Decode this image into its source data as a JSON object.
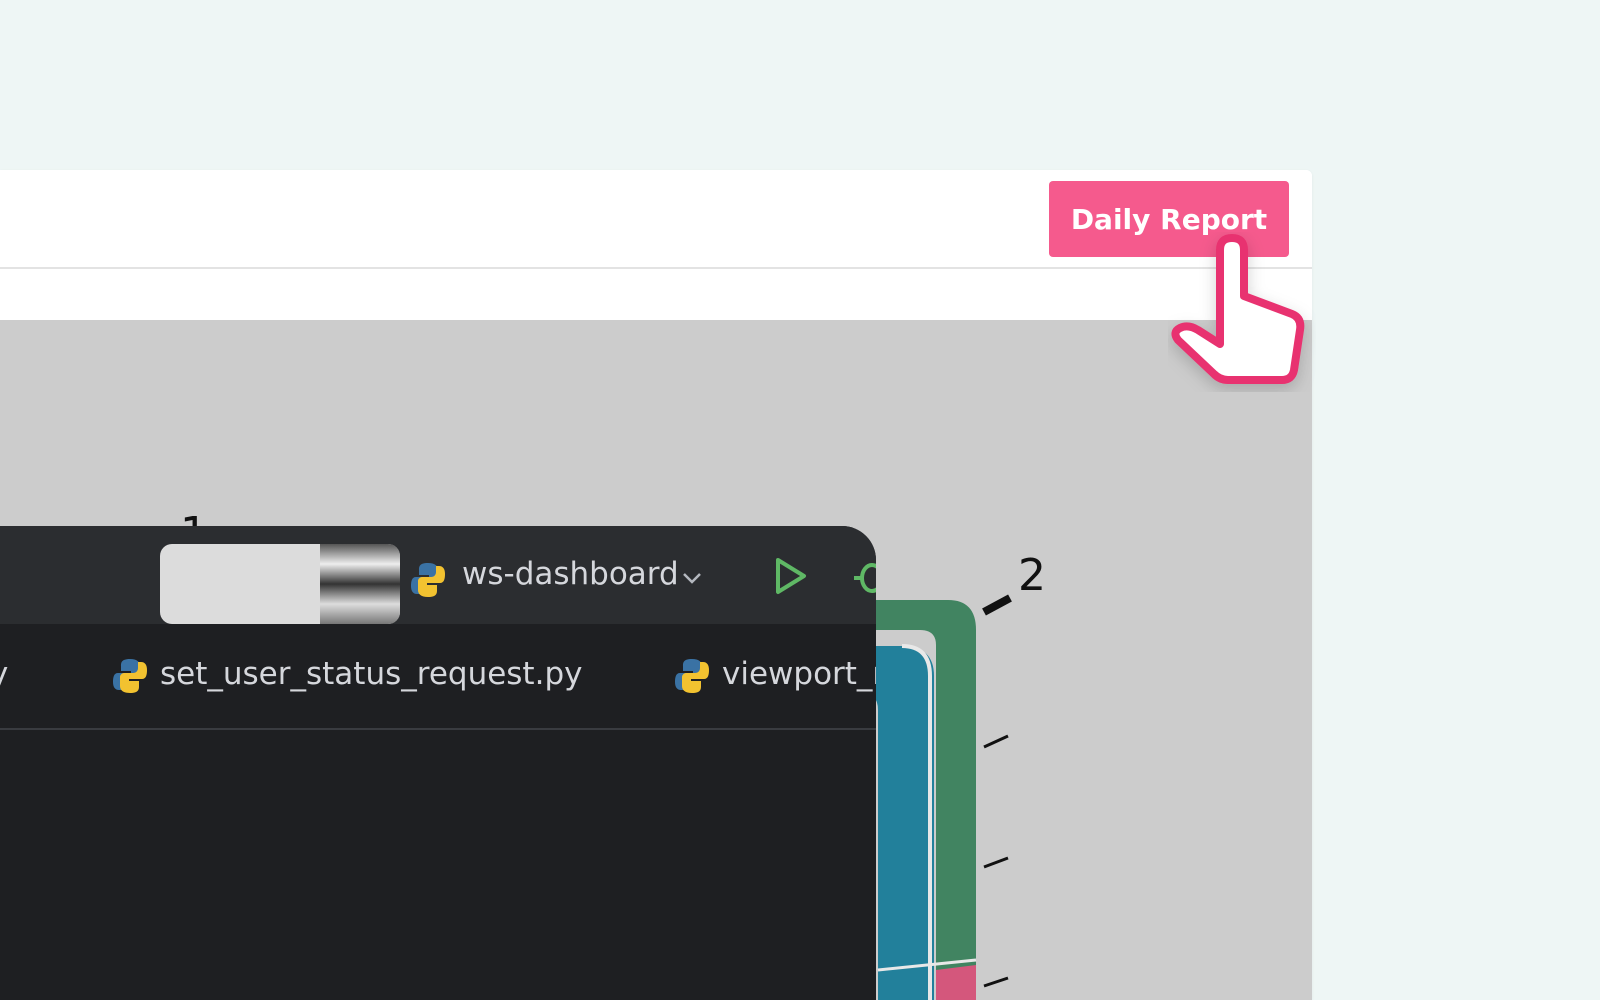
{
  "header": {
    "report_button_label": "Daily Report"
  },
  "ruler": {
    "labels": [
      "1",
      "2"
    ]
  },
  "ide": {
    "project_name": "ws-dashboard",
    "tabs": [
      {
        "label": "set_user_status_request.py"
      },
      {
        "label": "viewport_r"
      }
    ],
    "partial_tab_fragment": "y"
  },
  "colors": {
    "accent_button": "#f55a8d",
    "cursor": "#e8336f",
    "teal_band": "#22809b",
    "green_band": "#418461",
    "ide_bg": "#1e1f22"
  },
  "icons": [
    "python-icon",
    "chevron-down-icon",
    "run-icon",
    "debug-icon",
    "hand-pointer-icon"
  ]
}
